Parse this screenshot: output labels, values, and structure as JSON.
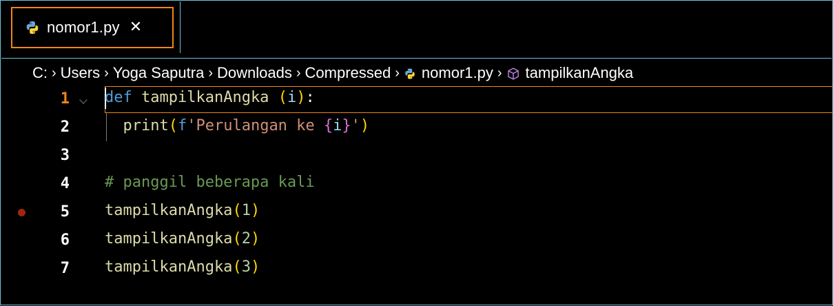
{
  "tab": {
    "filename": "nomor1.py",
    "close_glyph": "✕",
    "icon": "python-icon"
  },
  "breadcrumb": {
    "items": [
      "C:",
      "Users",
      "Yoga Saputra",
      "Downloads",
      "Compressed",
      "nomor1.py",
      "tampilkanAngka"
    ],
    "separator": "›"
  },
  "editor": {
    "active_line": 1,
    "breakpoint_line": 5,
    "lines": [
      {
        "number": "1",
        "text": "def tampilkanAngka (i):"
      },
      {
        "number": "2",
        "text": "  print(f'Perulangan ke {i}')"
      },
      {
        "number": "3",
        "text": ""
      },
      {
        "number": "4",
        "text": "# panggil beberapa kali"
      },
      {
        "number": "5",
        "text": "tampilkanAngka(1)"
      },
      {
        "number": "6",
        "text": "tampilkanAngka(2)"
      },
      {
        "number": "7",
        "text": "tampilkanAngka(3)"
      }
    ],
    "tokens": {
      "l1_kw": "def",
      "l1_fn": "tampilkanAngka",
      "l1_open": "(",
      "l1_param": "i",
      "l1_close": ")",
      "l1_colon": ":",
      "l2_fn": "print",
      "l2_open": "(",
      "l2_fprefix": "f",
      "l2_str": "'Perulangan ke ",
      "l2_brace_open": "{",
      "l2_var": "i",
      "l2_brace_close": "}",
      "l2_str_end": "'",
      "l2_close": ")",
      "l4_comment": "# panggil beberapa kali",
      "call_fn": "tampilkanAngka",
      "l5_arg": "1",
      "l6_arg": "2",
      "l7_arg": "3",
      "open": "(",
      "close": ")"
    }
  },
  "colors": {
    "accent": "#f38518",
    "border": "#6fc3df",
    "keyword": "#569cd6",
    "function": "#dcdcaa",
    "string": "#ce9178",
    "comment": "#6a9955",
    "number": "#b5cea8",
    "bracket": "#ffd700",
    "breakpoint": "#a1260d"
  }
}
